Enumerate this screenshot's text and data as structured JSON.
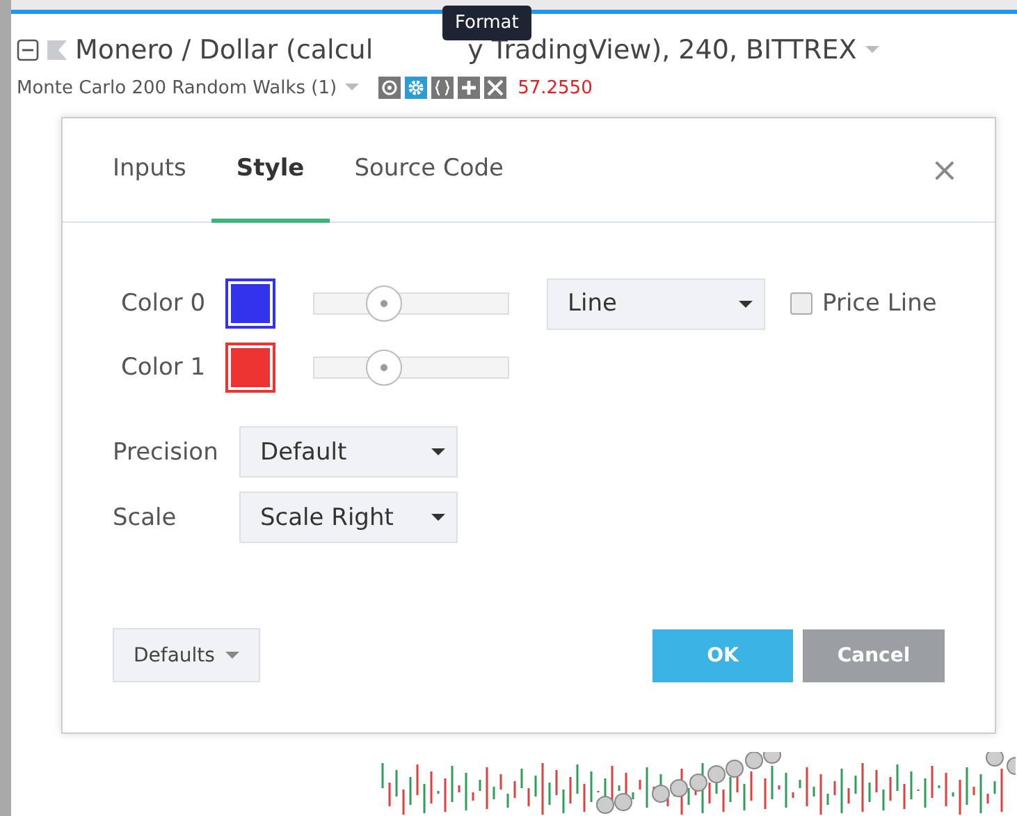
{
  "legend": {
    "title_parts": [
      "Monero / Dollar (calcul",
      "y TradingView), 240, BITTREX"
    ],
    "tooltip": "Format",
    "indicator": "Monte Carlo 200 Random Walks (1)",
    "buttons": [
      {
        "kind": "eye",
        "active": false
      },
      {
        "kind": "gear",
        "active": true
      },
      {
        "kind": "braces",
        "active": false
      },
      {
        "kind": "plus",
        "active": false
      },
      {
        "kind": "close",
        "active": false
      }
    ],
    "value": "57.2550"
  },
  "dialog": {
    "tabs": [
      {
        "label": "Inputs",
        "selected": false
      },
      {
        "label": "Style",
        "selected": true
      },
      {
        "label": "Source Code",
        "selected": false
      }
    ],
    "close": "×",
    "plots": [
      {
        "label": "Color 0",
        "color": "#3333ee",
        "level": 0.33,
        "type": "Line",
        "price_line": {
          "label": "Price Line",
          "checked": false
        }
      },
      {
        "label": "Color 1",
        "color": "#ee3333",
        "level": 0.33
      }
    ],
    "precision": {
      "label": "Precision",
      "value": "Default"
    },
    "scale": {
      "label": "Scale",
      "value": "Scale Right"
    },
    "defaults": "Defaults",
    "ok": "OK",
    "cancel": "Cancel"
  }
}
